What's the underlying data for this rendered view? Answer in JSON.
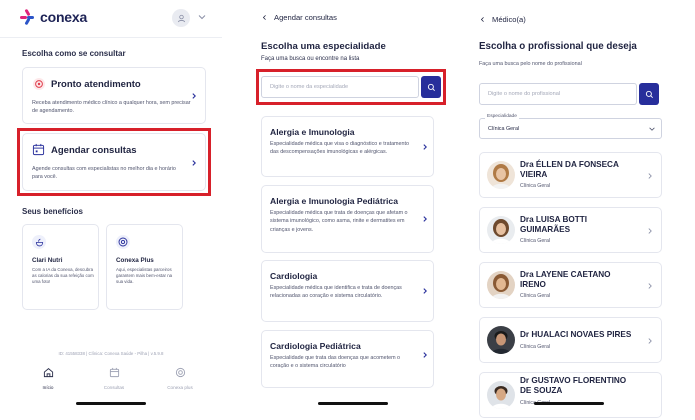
{
  "colors": {
    "primary": "#272e9b",
    "highlight": "#d7202a",
    "logo_magenta": "#e0237b",
    "logo_blue": "#2c55c8"
  },
  "home": {
    "logo_text": "conexa",
    "choose_title": "Escolha como se consultar",
    "options": [
      {
        "icon": "pulse-target-icon",
        "title": "Pronto atendimento",
        "desc": "Receba atendimento médico clínico a qualquer hora, sem precisar de agendamento."
      },
      {
        "icon": "calendar-icon",
        "title": "Agendar consultas",
        "desc": "Agende consultas com especialistas no melhor dia e horário para você."
      }
    ],
    "benefits_title": "Seus benefícios",
    "benefits": [
      {
        "icon": "nutrition-icon",
        "title": "Clari Nutri",
        "desc": "Com a IA da Conexa, descubra as calorias da sua refeição com uma foto!"
      },
      {
        "icon": "plus-target-icon",
        "title": "Conexa Plus",
        "desc": "Aqui, especialistas parceiros garantem mais bem-estar na sua vida."
      }
    ],
    "footer_id": "ID: 41558338 | Clínica: Conexa Saúde - Pilha | v.5.9.8",
    "nav": [
      {
        "icon": "home-icon",
        "label": "Início"
      },
      {
        "icon": "calendar-icon",
        "label": "Consultas"
      },
      {
        "icon": "plus-target-icon",
        "label": "Conexa plus"
      }
    ]
  },
  "specialties": {
    "back_title": "Agendar consultas",
    "heading": "Escolha uma especialidade",
    "subheading": "Faça uma busca ou encontre na lista",
    "search_placeholder": "Digite o nome da especialidade",
    "items": [
      {
        "title": "Alergia e Imunologia",
        "desc": "Especialidade médica que visa o diagnóstico e tratamento das descompensações imunológicas e alérgicas."
      },
      {
        "title": "Alergia e Imunologia Pediátrica",
        "desc": "Especialidade médica que trata de doenças que afetam o sistema imunológico, como asma, rinite e dermatites em crianças e jovens."
      },
      {
        "title": "Cardiologia",
        "desc": "Especialidade médica que identifica e trata de doenças relacionadas ao coração e sistema circulatório."
      },
      {
        "title": "Cardiologia Pediátrica",
        "desc": "Especialidade que trata das doenças que acometem o coração e o sistema circulatório"
      }
    ]
  },
  "doctors": {
    "back_title": "Médico(a)",
    "heading": "Escolha o profissional que deseja",
    "subheading": "Faça uma busca pelo nome do profissional",
    "search_placeholder": "Digite o nome do profissional",
    "filter_label": "Especialidade",
    "filter_value": "Clínica Geral",
    "items": [
      {
        "name": "Dra ÉLLEN DA FONSECA VIEIRA",
        "specialty": "Clínica Geral"
      },
      {
        "name": "Dra LUISA BOTTI GUIMARÃES",
        "specialty": "Clínica Geral"
      },
      {
        "name": "Dra LAYENE CAETANO IRENO",
        "specialty": "Clínica Geral"
      },
      {
        "name": "Dr HUALACI NOVAES PIRES",
        "specialty": "Clínica Geral"
      },
      {
        "name": "Dr GUSTAVO FLORENTINO DE SOUZA",
        "specialty": "Clínica Geral"
      }
    ]
  }
}
